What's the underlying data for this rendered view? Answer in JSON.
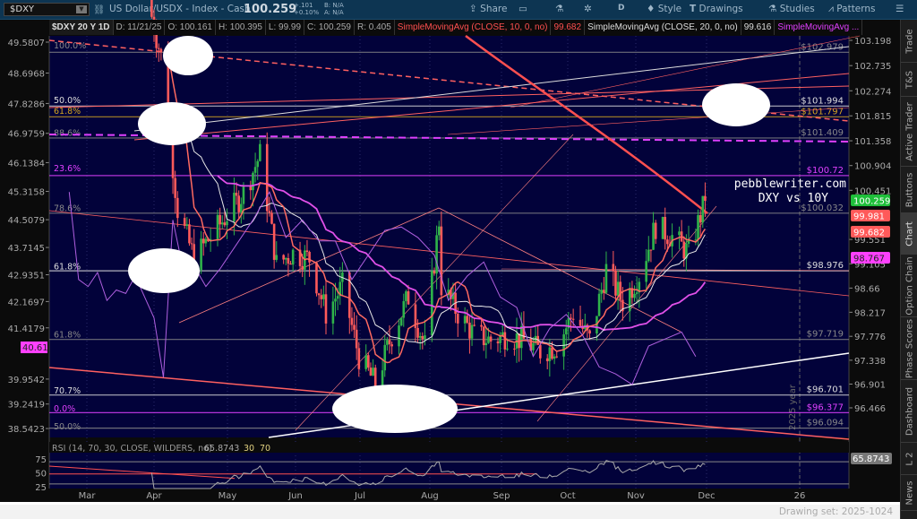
{
  "header": {
    "symbol": "$DXY",
    "description": "US Dollar/USDX - Index - Cash",
    "last": "100.259",
    "change": "+.101",
    "change_pct": "+0.10%",
    "bid": "B: N/A",
    "ask": "A: N/A"
  },
  "toolbar": {
    "share": "Share",
    "period": "D",
    "style": "Style",
    "drawings": "Drawings",
    "studies": "Studies",
    "patterns": "Patterns"
  },
  "info": {
    "title": "$DXY 20 Y 1D",
    "date": "D: 11/21/25",
    "open": "O: 100.161",
    "high": "H: 100.395",
    "low": "L: 99.99",
    "close": "C: 100.259",
    "range": "R: 0.405",
    "sma10": "SimpleMovingAvg (CLOSE, 10, 0, no)",
    "sma10_val": "99.682",
    "sma20": "SimpleMovingAvg (CLOSE, 20, 0, no)",
    "sma20_val": "99.616",
    "sma3": "SimpleMovingAvg ..."
  },
  "side_tabs": [
    "Trade",
    "T&S",
    "Active Trader",
    "Buttons",
    "Chart",
    "Option Chain",
    "Phase Scores",
    "Dashboard",
    "L 2",
    "News"
  ],
  "drawing_set": "Drawing set: 2025-1024",
  "colors": {
    "bg": "#02023a",
    "up": "#2fb34a",
    "down": "#ff5a5a",
    "sma10": "#ff6a60",
    "sma20": "#e8e8e8",
    "sma_long": "#e050e8",
    "yield10": "#b060e0",
    "fib_gold": "#d4a520",
    "magenta": "#e040ff"
  },
  "chart_data": {
    "type": "candlestick",
    "title": "$DXY 20 Y 1D",
    "annotation": [
      "pebblewriter.com",
      "DXY vs 10Y"
    ],
    "year_marker": "2025 year",
    "x_ticks": [
      "Mar",
      "Apr",
      "May",
      "Jun",
      "Jul",
      "Aug",
      "Sep",
      "Oct",
      "Nov",
      "Dec",
      "26"
    ],
    "right_axis_ticks": [
      "103.198",
      "102.735",
      "102.274",
      "101.815",
      "101.358",
      "100.904",
      "100.451",
      "99.551",
      "99.105",
      "98.66",
      "98.217",
      "97.776",
      "97.338",
      "96.901",
      "96.466"
    ],
    "left_axis_ticks": [
      "49.5807",
      "48.6968",
      "47.8286",
      "46.9759",
      "46.1384",
      "45.3158",
      "44.5079",
      "43.7145",
      "42.9351",
      "42.1697",
      "41.4179",
      "39.9542",
      "39.2419",
      "38.5423"
    ],
    "right_badges": [
      {
        "text": "100.259",
        "color": "#1fbf3a"
      },
      {
        "text": "99.981",
        "color": "#ff5a5a"
      },
      {
        "text": "99.682",
        "color": "#ff5a5a"
      },
      {
        "text": "98.767",
        "color": "#ff40ff"
      }
    ],
    "left_badge": "40.61",
    "price_levels": [
      {
        "price": 102.979,
        "label": "$102.979",
        "color": "#888"
      },
      {
        "price": 101.994,
        "label": "$101.994",
        "color": "#ddd"
      },
      {
        "price": 101.797,
        "label": "$101.797",
        "color": "#d4a520"
      },
      {
        "price": 101.409,
        "label": "$101.409",
        "color": "#888"
      },
      {
        "price": 100.72,
        "label": "$100.72",
        "color": "#e040ff"
      },
      {
        "price": 100.032,
        "label": "$100.032",
        "color": "#888"
      },
      {
        "price": 98.976,
        "label": "$98.976",
        "color": "#ddd"
      },
      {
        "price": 97.719,
        "label": "$97.719",
        "color": "#888"
      },
      {
        "price": 96.701,
        "label": "$96.701",
        "color": "#ddd"
      },
      {
        "price": 96.377,
        "label": "$96.377",
        "color": "#e040ff"
      },
      {
        "price": 96.094,
        "label": "$96.094",
        "color": "#888"
      }
    ],
    "fib_labels": [
      {
        "text": "100.0%",
        "price": 103.1,
        "color": "#888"
      },
      {
        "text": "50.0%",
        "price": 102.1,
        "color": "#ddd"
      },
      {
        "text": "61.8%",
        "price": 101.9,
        "color": "#d4a520"
      },
      {
        "text": "88.6%",
        "price": 101.5,
        "color": "#888"
      },
      {
        "text": "23.6%",
        "price": 100.85,
        "color": "#e040ff"
      },
      {
        "text": "78.6%",
        "price": 100.12,
        "color": "#888"
      },
      {
        "text": "61.8%",
        "price": 99.05,
        "color": "#ddd"
      },
      {
        "text": "61.8%",
        "price": 97.8,
        "color": "#888"
      },
      {
        "text": "70.7%",
        "price": 96.78,
        "color": "#ddd"
      },
      {
        "text": "0.0%",
        "price": 96.45,
        "color": "#e040ff"
      },
      {
        "text": "50.0%",
        "price": 96.12,
        "color": "#888"
      }
    ],
    "dxy_weekly_close": {
      "day_offset_from_apr1": [
        -3,
        3,
        10,
        17,
        24,
        31,
        38,
        45,
        52,
        59,
        66,
        73,
        80,
        87,
        94,
        101,
        108,
        115,
        121,
        122,
        129,
        136,
        143,
        150,
        157,
        164,
        171,
        178,
        185,
        192,
        199,
        206,
        213,
        220,
        227,
        234
      ],
      "close": [
        104.0,
        102.9,
        100.1,
        99.2,
        99.6,
        100.0,
        100.4,
        101.1,
        99.1,
        99.3,
        99.2,
        98.2,
        98.7,
        97.4,
        96.9,
        97.8,
        98.5,
        97.6,
        99.9,
        98.7,
        98.2,
        97.8,
        97.7,
        97.8,
        97.7,
        97.5,
        97.6,
        98.2,
        97.7,
        99.0,
        98.4,
        98.9,
        99.8,
        99.6,
        99.3,
        100.259
      ]
    },
    "us10y_x10": {
      "day_offset_from_apr1": [
        -36,
        -32,
        -28,
        -24,
        -20,
        -16,
        -12,
        -8,
        -4,
        0,
        4,
        8,
        12,
        16,
        22,
        28,
        35,
        42,
        49,
        56,
        63,
        70,
        77,
        84,
        91,
        98,
        105,
        112,
        119,
        125,
        133,
        140,
        147,
        154,
        161,
        168,
        175,
        182,
        189,
        196,
        203,
        210,
        217,
        224,
        230
      ],
      "value": [
        45.3,
        42.8,
        42.6,
        43.0,
        42.2,
        42.5,
        42.4,
        42.9,
        42.3,
        41.7,
        40.0,
        44.5,
        43.2,
        43.3,
        42.6,
        43.1,
        43.8,
        44.5,
        45.3,
        44.0,
        44.5,
        43.9,
        43.9,
        42.8,
        43.5,
        44.2,
        44.3,
        44.0,
        43.5,
        42.2,
        42.9,
        43.3,
        42.3,
        42.0,
        40.6,
        41.4,
        41.8,
        41.2,
        40.3,
        40.1,
        39.8,
        40.9,
        41.1,
        41.3,
        40.6
      ]
    },
    "rsi": {
      "label": "RSI (14, 70, 30, CLOSE, WILDERS, no)",
      "value": "65.8743",
      "oversold": "30",
      "overbought": "70",
      "ticks": [
        "75",
        "50",
        "25"
      ]
    }
  }
}
